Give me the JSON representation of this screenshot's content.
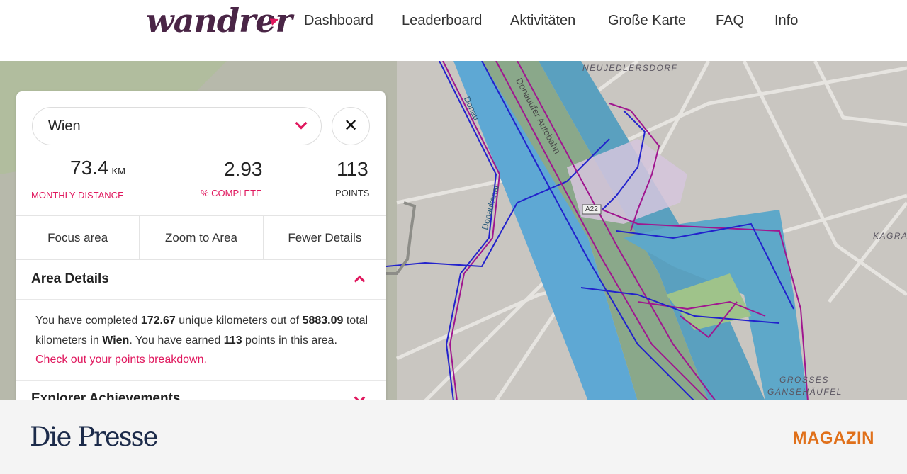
{
  "header": {
    "logo_text": "wandrer",
    "nav": [
      "Dashboard",
      "Leaderboard",
      "Aktivitäten",
      "Große Karte",
      "FAQ",
      "Info"
    ]
  },
  "map": {
    "labels": {
      "neujedlersdorf": "NEUJEDLERSDORF",
      "kagran": "KAGRAN",
      "gaensehaeufel_1": "GROSSES",
      "gaensehaeufel_2": "GÄNSEHÄUFEL",
      "donau": "Donau",
      "donauufer": "Donauufer Autobahn",
      "donaukanal": "Donaukanal",
      "a22": "A22"
    },
    "colors": {
      "water": "#6bb0d4",
      "park": "#a6c48a",
      "route_new": "#2222cc",
      "route_old": "#a0168f"
    }
  },
  "panel": {
    "area_select": {
      "value": "Wien"
    },
    "close_label": "✕",
    "stats": {
      "distance": {
        "value": "73.4",
        "unit": "KM",
        "label": "MONTHLY DISTANCE"
      },
      "complete": {
        "value": "2.93",
        "label": "% COMPLETE"
      },
      "points": {
        "value": "113",
        "label": "POINTS"
      }
    },
    "buttons": {
      "focus": "Focus area",
      "zoom": "Zoom to Area",
      "fewer": "Fewer Details"
    },
    "area_details": {
      "title": "Area Details",
      "t1": "You have completed ",
      "km_done": "172.67",
      "t2": " unique kilometers out of ",
      "km_total": "5883.09",
      "t3": " total kilometers in ",
      "area": "Wien",
      "t4": ". You have earned ",
      "points": "113",
      "t5": " points in this area. ",
      "link": "Check out your points breakdown."
    },
    "explorer": {
      "title": "Explorer Achievements"
    }
  },
  "footer": {
    "logo": "Die Presse",
    "section": "MAGAZIN"
  }
}
